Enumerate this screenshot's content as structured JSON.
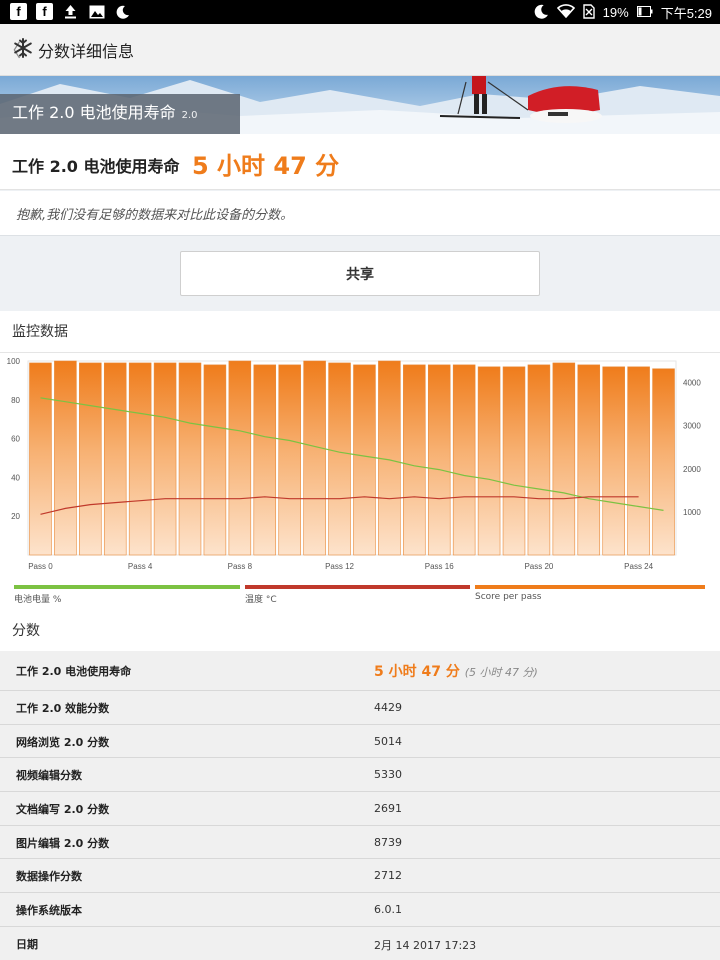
{
  "status_bar": {
    "battery": "19%",
    "time": "下午5:29"
  },
  "app_bar": {
    "back": "〈",
    "title": "分数详细信息"
  },
  "banner": {
    "title": "工作 2.0 电池使用寿命",
    "version": "2.0"
  },
  "result": {
    "label": "工作 2.0 电池使用寿命",
    "value": "5 小时 47 分"
  },
  "notice": "抱歉,我们没有足够的数据来对比此设备的分数。",
  "share_label": "共享",
  "monitor": {
    "title": "监控数据",
    "legend": [
      "电池电量 %",
      "温度 °C",
      "Score per pass"
    ]
  },
  "scores": {
    "title": "分数",
    "rows": [
      {
        "key": "工作 2.0 电池使用寿命",
        "value": "5 小时 47 分",
        "extra": "(5 小时 47 分)"
      },
      {
        "key": "工作 2.0 效能分数",
        "value": "4429"
      },
      {
        "key": "网络浏览 2.0 分数",
        "value": "5014"
      },
      {
        "key": "视频编辑分数",
        "value": "5330"
      },
      {
        "key": "文档编写 2.0 分数",
        "value": "2691"
      },
      {
        "key": "图片编辑 2.0 分数",
        "value": "8739"
      },
      {
        "key": "数据操作分数",
        "value": "2712"
      },
      {
        "key": "操作系统版本",
        "value": "6.0.1"
      },
      {
        "key": "日期",
        "value": "2月 14 2017 17:23"
      }
    ]
  },
  "colors": {
    "accent": "#ef7c1b",
    "battery": "#7cc242",
    "temperature": "#c0392b",
    "bar": "#f08a2c"
  },
  "chart_data": {
    "type": "bar",
    "x_ticks": [
      "Pass 0",
      "Pass 4",
      "Pass 8",
      "Pass 12",
      "Pass 16",
      "Pass 20",
      "Pass 24"
    ],
    "y_left_ticks": [
      20,
      40,
      60,
      80,
      100
    ],
    "y_right_ticks": [
      1000,
      2000,
      3000,
      4000
    ],
    "ylim_left": [
      0,
      100
    ],
    "series": [
      {
        "name": "Score per pass",
        "axis": "left",
        "type": "bar",
        "values": [
          99,
          100,
          99,
          99,
          99,
          99,
          99,
          98,
          100,
          98,
          98,
          100,
          99,
          98,
          100,
          98,
          98,
          98,
          97,
          97,
          98,
          99,
          98,
          97,
          97,
          96
        ]
      },
      {
        "name": "电池电量 %",
        "axis": "left",
        "type": "line",
        "values": [
          81,
          79,
          77,
          75,
          73,
          71,
          68,
          66,
          64,
          61,
          59,
          56,
          53,
          51,
          49,
          46,
          44,
          41,
          39,
          36,
          34,
          32,
          29,
          27,
          25,
          23
        ]
      },
      {
        "name": "温度 °C",
        "axis": "left",
        "type": "line",
        "values": [
          21,
          24,
          26,
          27,
          28,
          29,
          29,
          29,
          29,
          30,
          29,
          29,
          29,
          30,
          29,
          30,
          29,
          30,
          30,
          30,
          29,
          29,
          30,
          30,
          30
        ]
      }
    ]
  }
}
